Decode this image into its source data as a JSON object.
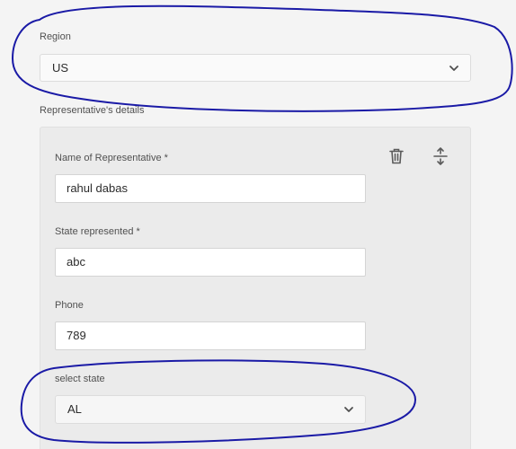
{
  "region": {
    "label": "Region",
    "value": "US"
  },
  "representative_section": {
    "label": "Representative's details"
  },
  "representative": {
    "name_label": "Name of Representative *",
    "name_value": "rahul dabas",
    "state_label": "State represented *",
    "state_value": "abc",
    "phone_label": "Phone",
    "phone_value": "789",
    "select_state_label": "select state",
    "select_state_value": "AL"
  },
  "icons": {
    "delete": "trash-icon",
    "reorder": "move-vertical-icon",
    "dropdown": "chevron-down-icon"
  },
  "colors": {
    "annotation_stroke": "#1a1aa6",
    "background": "#f4f4f4",
    "panel": "#ebebeb"
  }
}
